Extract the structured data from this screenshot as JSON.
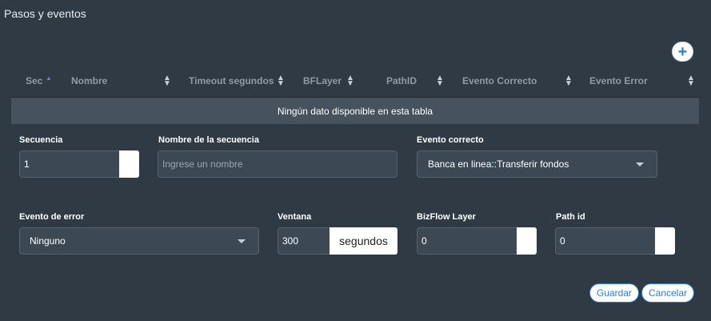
{
  "panel": {
    "title": "Pasos y eventos"
  },
  "table": {
    "columns": [
      "Sec",
      "Nombre",
      "Timeout segundos",
      "BFLayer",
      "PathID",
      "Evento Correcto",
      "Evento Error"
    ],
    "empty_text": "Ningún dato disponible en esta tabla"
  },
  "form": {
    "secuencia": {
      "label": "Secuencia",
      "value": "1"
    },
    "nombre": {
      "label": "Nombre de la secuencia",
      "placeholder": "Ingrese un nombre"
    },
    "evento_correcto": {
      "label": "Evento correcto",
      "value": "Banca en linea::Transferir fondos"
    },
    "evento_error": {
      "label": "Evento de error",
      "value": "Ninguno"
    },
    "ventana": {
      "label": "Ventana",
      "value": "300",
      "suffix": "segundos"
    },
    "bizflow_layer": {
      "label": "BizFlow Layer",
      "value": "0"
    },
    "path_id": {
      "label": "Path id",
      "value": "0"
    }
  },
  "actions": {
    "save": "Guardar",
    "cancel": "Cancelar"
  },
  "colors": {
    "background": "#2f3a45",
    "accent": "#2a7fd4",
    "row": "#46525e"
  }
}
